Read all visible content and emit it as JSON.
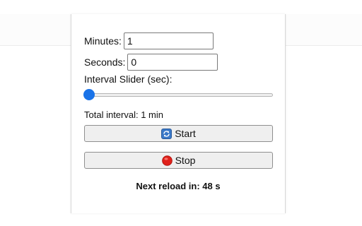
{
  "form": {
    "minutes_label": "Minutes:",
    "minutes_value": "1",
    "seconds_label": "Seconds:",
    "seconds_value": "0",
    "slider_label": "Interval Slider (sec):",
    "slider_value_fraction": 0.0
  },
  "total_interval": "Total interval: 1 min",
  "buttons": {
    "start_label": "Start",
    "start_icon": "refresh-icon",
    "stop_label": "Stop",
    "stop_icon": "red-stop-circle-icon"
  },
  "next_reload": "Next reload in: 48 s",
  "colors": {
    "slider_thumb": "#1a73e8",
    "stop_icon": "#e0211b",
    "start_icon": "#3a78c8"
  }
}
